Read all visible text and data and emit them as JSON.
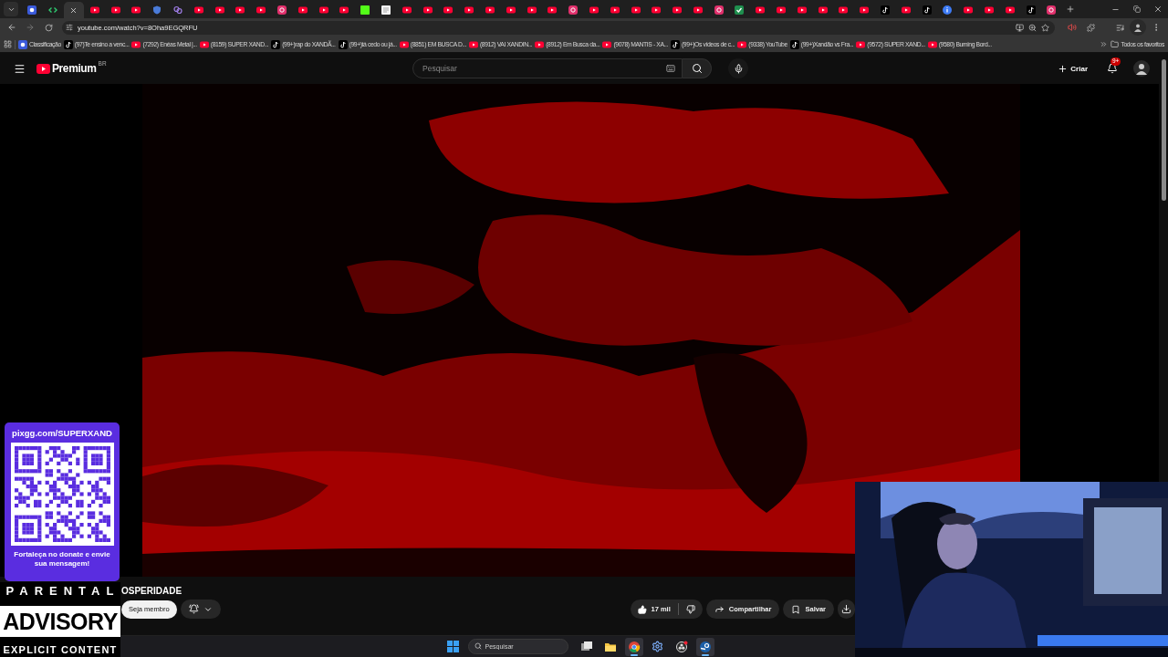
{
  "browser": {
    "tabs": [
      {
        "kind": "site",
        "selected": false
      },
      {
        "kind": "code",
        "selected": false
      },
      {
        "selected": true
      },
      {
        "kind": "youtube",
        "selected": false
      },
      {
        "kind": "youtube",
        "selected": false
      },
      {
        "kind": "youtube",
        "selected": false
      },
      {
        "kind": "shield",
        "selected": false
      },
      {
        "kind": "hub",
        "selected": false
      },
      {
        "kind": "youtube",
        "selected": false
      },
      {
        "kind": "youtube",
        "selected": false
      },
      {
        "kind": "youtube",
        "selected": false
      },
      {
        "kind": "youtube",
        "selected": false
      },
      {
        "kind": "instagram",
        "selected": false
      },
      {
        "kind": "youtube",
        "selected": false
      },
      {
        "kind": "youtube",
        "selected": false
      },
      {
        "kind": "youtube",
        "selected": false
      },
      {
        "kind": "k",
        "selected": false
      },
      {
        "kind": "doc",
        "selected": false
      },
      {
        "kind": "youtube",
        "selected": false
      },
      {
        "kind": "youtube",
        "selected": false
      },
      {
        "kind": "youtube",
        "selected": false
      },
      {
        "kind": "youtube",
        "selected": false
      },
      {
        "kind": "youtube",
        "selected": false
      },
      {
        "kind": "youtube",
        "selected": false
      },
      {
        "kind": "youtube",
        "selected": false
      },
      {
        "kind": "youtube",
        "selected": false
      },
      {
        "kind": "instagram",
        "selected": false
      },
      {
        "kind": "youtube",
        "selected": false
      },
      {
        "kind": "youtube",
        "selected": false
      },
      {
        "kind": "youtube",
        "selected": false
      },
      {
        "kind": "youtube",
        "selected": false
      },
      {
        "kind": "youtube",
        "selected": false
      },
      {
        "kind": "youtube",
        "selected": false
      },
      {
        "kind": "instagram",
        "selected": false
      },
      {
        "kind": "v",
        "selected": false
      },
      {
        "kind": "youtube",
        "selected": false
      },
      {
        "kind": "youtube",
        "selected": false
      },
      {
        "kind": "youtube",
        "selected": false
      },
      {
        "kind": "youtube",
        "selected": false
      },
      {
        "kind": "youtube",
        "selected": false
      },
      {
        "kind": "youtube",
        "selected": false
      },
      {
        "kind": "tiktok",
        "selected": false
      },
      {
        "kind": "youtube",
        "selected": false
      },
      {
        "kind": "tiktok",
        "selected": false
      },
      {
        "kind": "info",
        "selected": false
      },
      {
        "kind": "youtube",
        "selected": false
      },
      {
        "kind": "youtube",
        "selected": false
      },
      {
        "kind": "youtube",
        "selected": false
      },
      {
        "kind": "tiktok",
        "selected": false
      },
      {
        "kind": "instagram",
        "selected": false
      }
    ],
    "url": "youtube.com/watch?v=8Oha9EGQRFU",
    "bookmarks": [
      {
        "kind": "site",
        "label": "Classificação"
      },
      {
        "kind": "tiktok",
        "label": "(97)Te ensino a venc..."
      },
      {
        "kind": "youtube",
        "label": "(7292) Enéas Metal |..."
      },
      {
        "kind": "youtube",
        "label": "(8159) SUPER XAND..."
      },
      {
        "kind": "tiktok",
        "label": "(99+)rap do XANDÃ..."
      },
      {
        "kind": "tiktok",
        "label": "(99+)tá cedo ou já..."
      },
      {
        "kind": "youtube",
        "label": "(8851) EM BUSCA D..."
      },
      {
        "kind": "youtube",
        "label": "(8912) VAI XANDIN..."
      },
      {
        "kind": "youtube",
        "label": "(8912) Em Busca da..."
      },
      {
        "kind": "youtube",
        "label": "(9078) MANTIS - XA..."
      },
      {
        "kind": "tiktok",
        "label": "(99+)Os vídeos de c..."
      },
      {
        "kind": "youtube",
        "label": "(9338) YouTube"
      },
      {
        "kind": "tiktok",
        "label": "(99+)Xandão vs Fra..."
      },
      {
        "kind": "youtube",
        "label": "(9572) SUPER XAND..."
      },
      {
        "kind": "youtube",
        "label": "(9580) Burning Bord..."
      }
    ],
    "all_bookmarks": "Todos os favoritos"
  },
  "youtube": {
    "logo": "Premium",
    "region": "BR",
    "search": {
      "placeholder": "Pesquisar"
    },
    "create": "Criar",
    "notifications": "9+",
    "video_title": "OSPERIDADE",
    "join": "Seja membro",
    "likes": "17 mil",
    "share": "Compartilhar",
    "save": "Salvar"
  },
  "overlay": {
    "qr_url": "pixgg.com/SUPERXAND",
    "qr_message": "Fortaleça no donate e envie sua mensagem!",
    "advisory": [
      "PARENTAL",
      "ADVISORY",
      "EXPLICIT CONTENT"
    ]
  },
  "taskbar": {
    "search": {
      "placeholder": "Pesquisar"
    },
    "apps": [
      {
        "kind": "taskview",
        "active": false
      },
      {
        "kind": "explorer",
        "active": false
      },
      {
        "kind": "chrome",
        "active": true
      },
      {
        "kind": "settings",
        "active": false
      },
      {
        "kind": "recorder",
        "active": false
      },
      {
        "kind": "steam",
        "active": true
      }
    ]
  }
}
